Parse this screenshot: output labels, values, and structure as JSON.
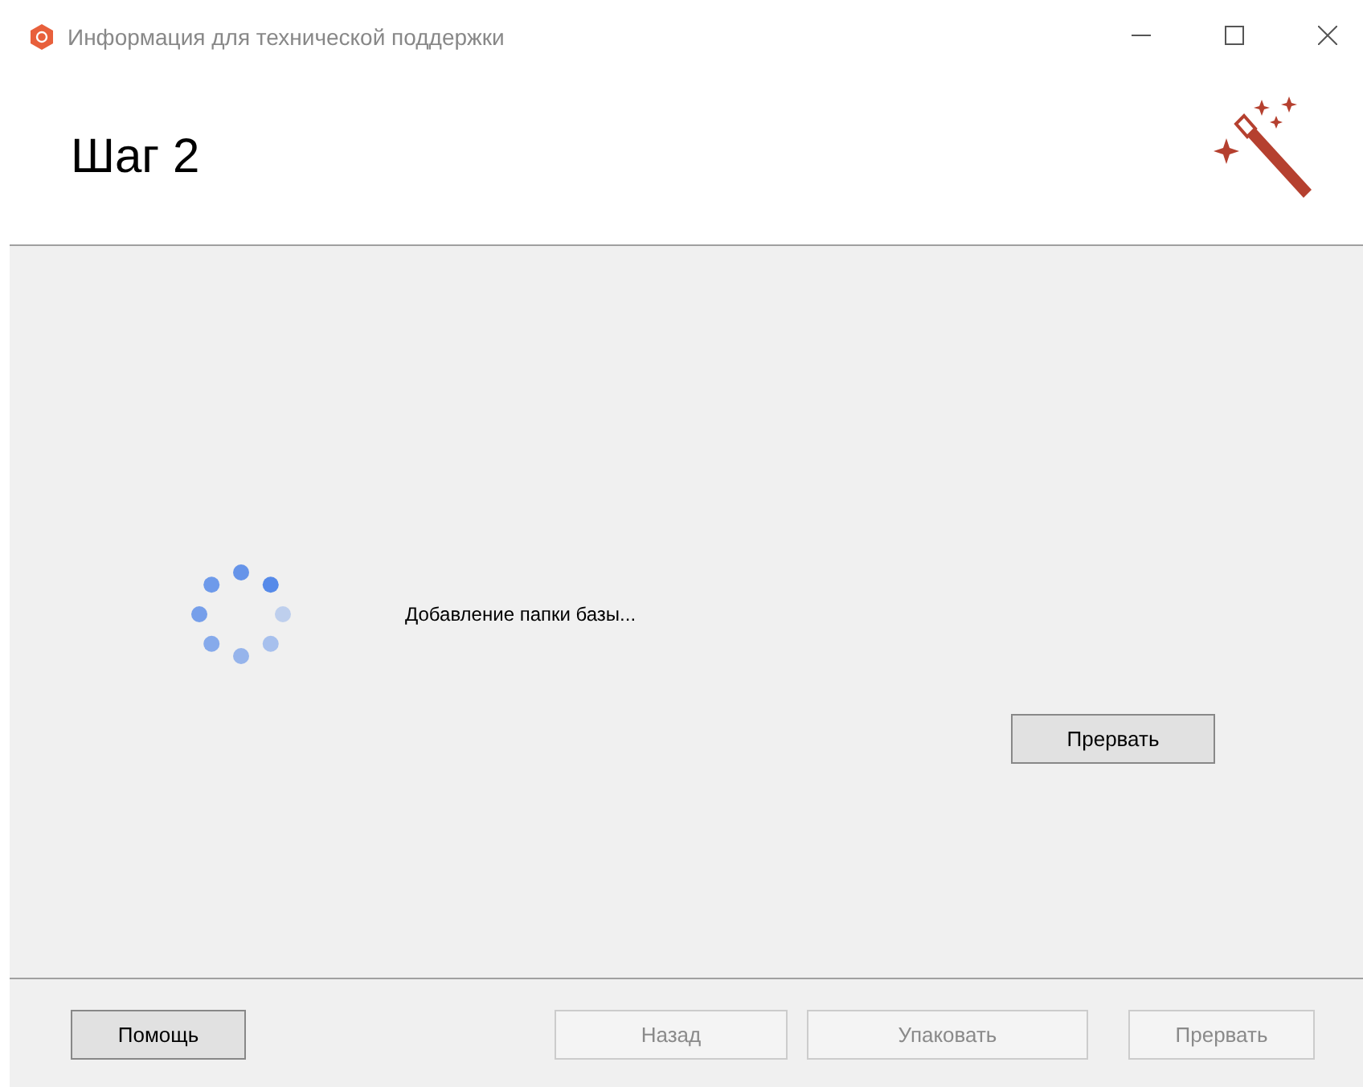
{
  "window": {
    "title": "Информация для технической поддержки"
  },
  "header": {
    "heading": "Шаг 2"
  },
  "progress": {
    "message": "Добавление папки базы..."
  },
  "action_button": {
    "label": "Прервать",
    "disabled": false
  },
  "footer_buttons": [
    {
      "label": "Помощь",
      "disabled": false
    },
    {
      "label": "Назад",
      "disabled": true
    },
    {
      "label": "Упаковать",
      "disabled": true
    },
    {
      "label": "Прервать",
      "disabled": true
    }
  ]
}
